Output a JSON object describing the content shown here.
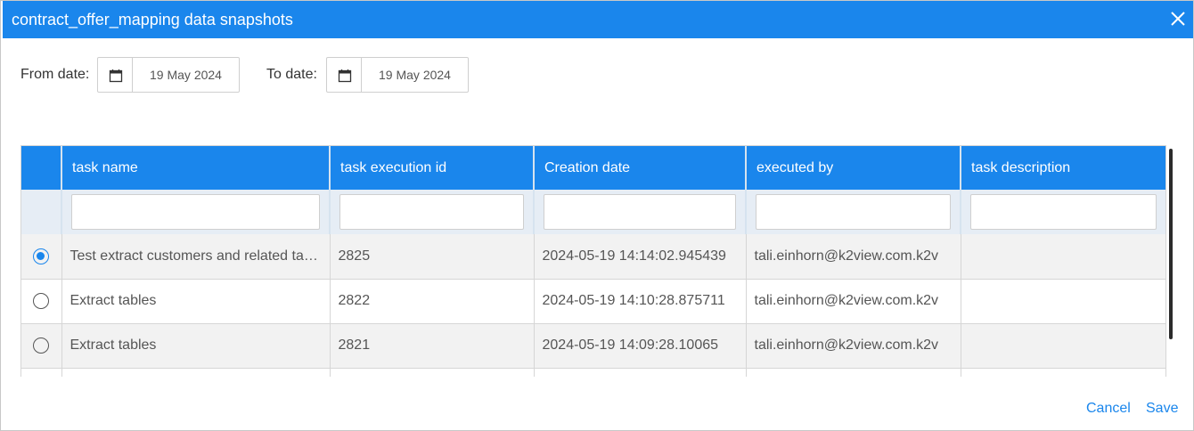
{
  "dialog": {
    "title": "contract_offer_mapping data snapshots"
  },
  "filters": {
    "from_label": "From date:",
    "from_value": "19 May 2024",
    "to_label": "To date:",
    "to_value": "19 May 2024"
  },
  "table": {
    "columns": [
      "task name",
      "task execution id",
      "Creation date",
      "executed by",
      "task description"
    ],
    "rows": [
      {
        "selected": true,
        "task_name": "Test extract customers and related tables",
        "task_execution_id": "2825",
        "creation_date": "2024-05-19 14:14:02.945439",
        "executed_by": "tali.einhorn@k2view.com.k2v",
        "task_description": ""
      },
      {
        "selected": false,
        "task_name": "Extract tables",
        "task_execution_id": "2822",
        "creation_date": "2024-05-19 14:10:28.875711",
        "executed_by": "tali.einhorn@k2view.com.k2v",
        "task_description": ""
      },
      {
        "selected": false,
        "task_name": "Extract tables",
        "task_execution_id": "2821",
        "creation_date": "2024-05-19 14:09:28.10065",
        "executed_by": "tali.einhorn@k2view.com.k2v",
        "task_description": ""
      },
      {
        "selected": false,
        "task_name": "",
        "task_execution_id": "",
        "creation_date": "",
        "executed_by": "",
        "task_description": ""
      }
    ]
  },
  "footer": {
    "cancel_label": "Cancel",
    "save_label": "Save"
  },
  "colors": {
    "accent": "#1a86ec"
  }
}
